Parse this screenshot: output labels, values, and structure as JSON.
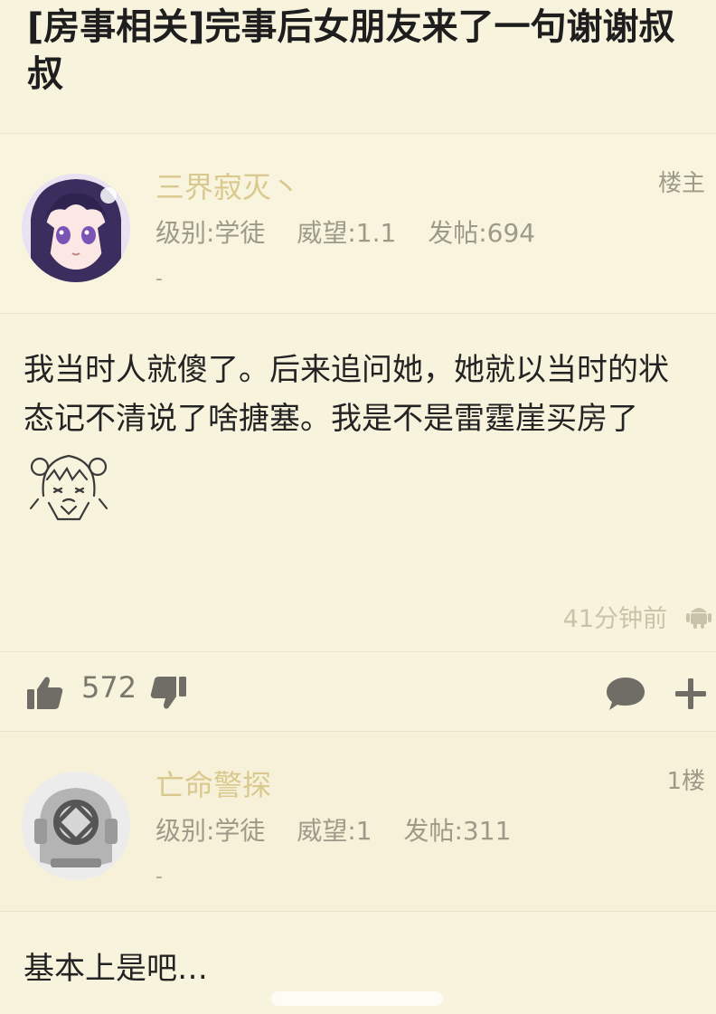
{
  "thread": {
    "title": "[房事相关]完事后女朋友来了一句谢谢叔叔"
  },
  "posts": [
    {
      "username": "三界寂灭丶",
      "level": "级别:学徒",
      "reputation": "威望:1.1",
      "posts": "发帖:694",
      "signature": "-",
      "floor": "楼主",
      "content": "我当时人就傻了。后来追问她，她就以当时的状态记不清说了啥搪塞。我是不是雷霆崖买房了",
      "time": "41分钟前",
      "likes": "572"
    },
    {
      "username": "亡命警探",
      "level": "级别:学徒",
      "reputation": "威望:1",
      "posts": "发帖:311",
      "signature": "-",
      "floor": "1楼",
      "content": "基本上是吧…"
    }
  ],
  "icons": {
    "like": "thumbs-up-icon",
    "dislike": "thumbs-down-icon",
    "comment": "comment-bubble-icon",
    "add": "plus-icon",
    "device": "android-icon",
    "sticker": "anime-sticker-icon"
  },
  "colors": {
    "background": "#f8f3dc",
    "username": "#d9c98e",
    "meta": "#9d9a8a",
    "icon": "#6f6d66"
  }
}
